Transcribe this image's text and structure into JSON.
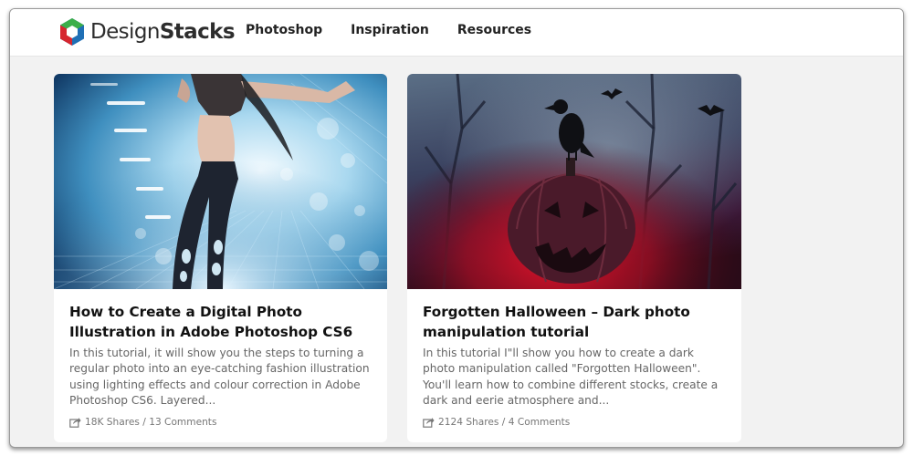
{
  "brand": {
    "name_light": "Design",
    "name_bold": "Stacks"
  },
  "nav": {
    "items": [
      "Photoshop",
      "Inspiration",
      "Resources"
    ]
  },
  "cards": [
    {
      "title": "How to Create a Digital Photo Illustration in Adobe Photoshop CS6",
      "excerpt": "In this tutorial, it will show you the steps to turning a regular photo into an eye-catching fashion illustration using lighting effects and colour correction in Adobe Photoshop CS6. Layered...",
      "shares": "18K Shares",
      "separator": " / ",
      "comments": "13 Comments",
      "image_icon": "dancer-illustration"
    },
    {
      "title": "Forgotten Halloween – Dark photo manipulation tutorial",
      "excerpt": "In this tutorial I\"ll show you how to create a dark photo manipulation called \"Forgotten Halloween\". You'll learn how to combine different stocks, create a dark and eerie atmosphere and...",
      "shares": "2124 Shares",
      "separator": " / ",
      "comments": "4 Comments",
      "image_icon": "halloween-raven-pumpkin"
    }
  ],
  "colors": {
    "page_bg": "#f2f2f2",
    "card_bg": "#ffffff",
    "logo_red": "#d6262f",
    "logo_green": "#3cae4a",
    "logo_blue": "#1f6fb5"
  }
}
